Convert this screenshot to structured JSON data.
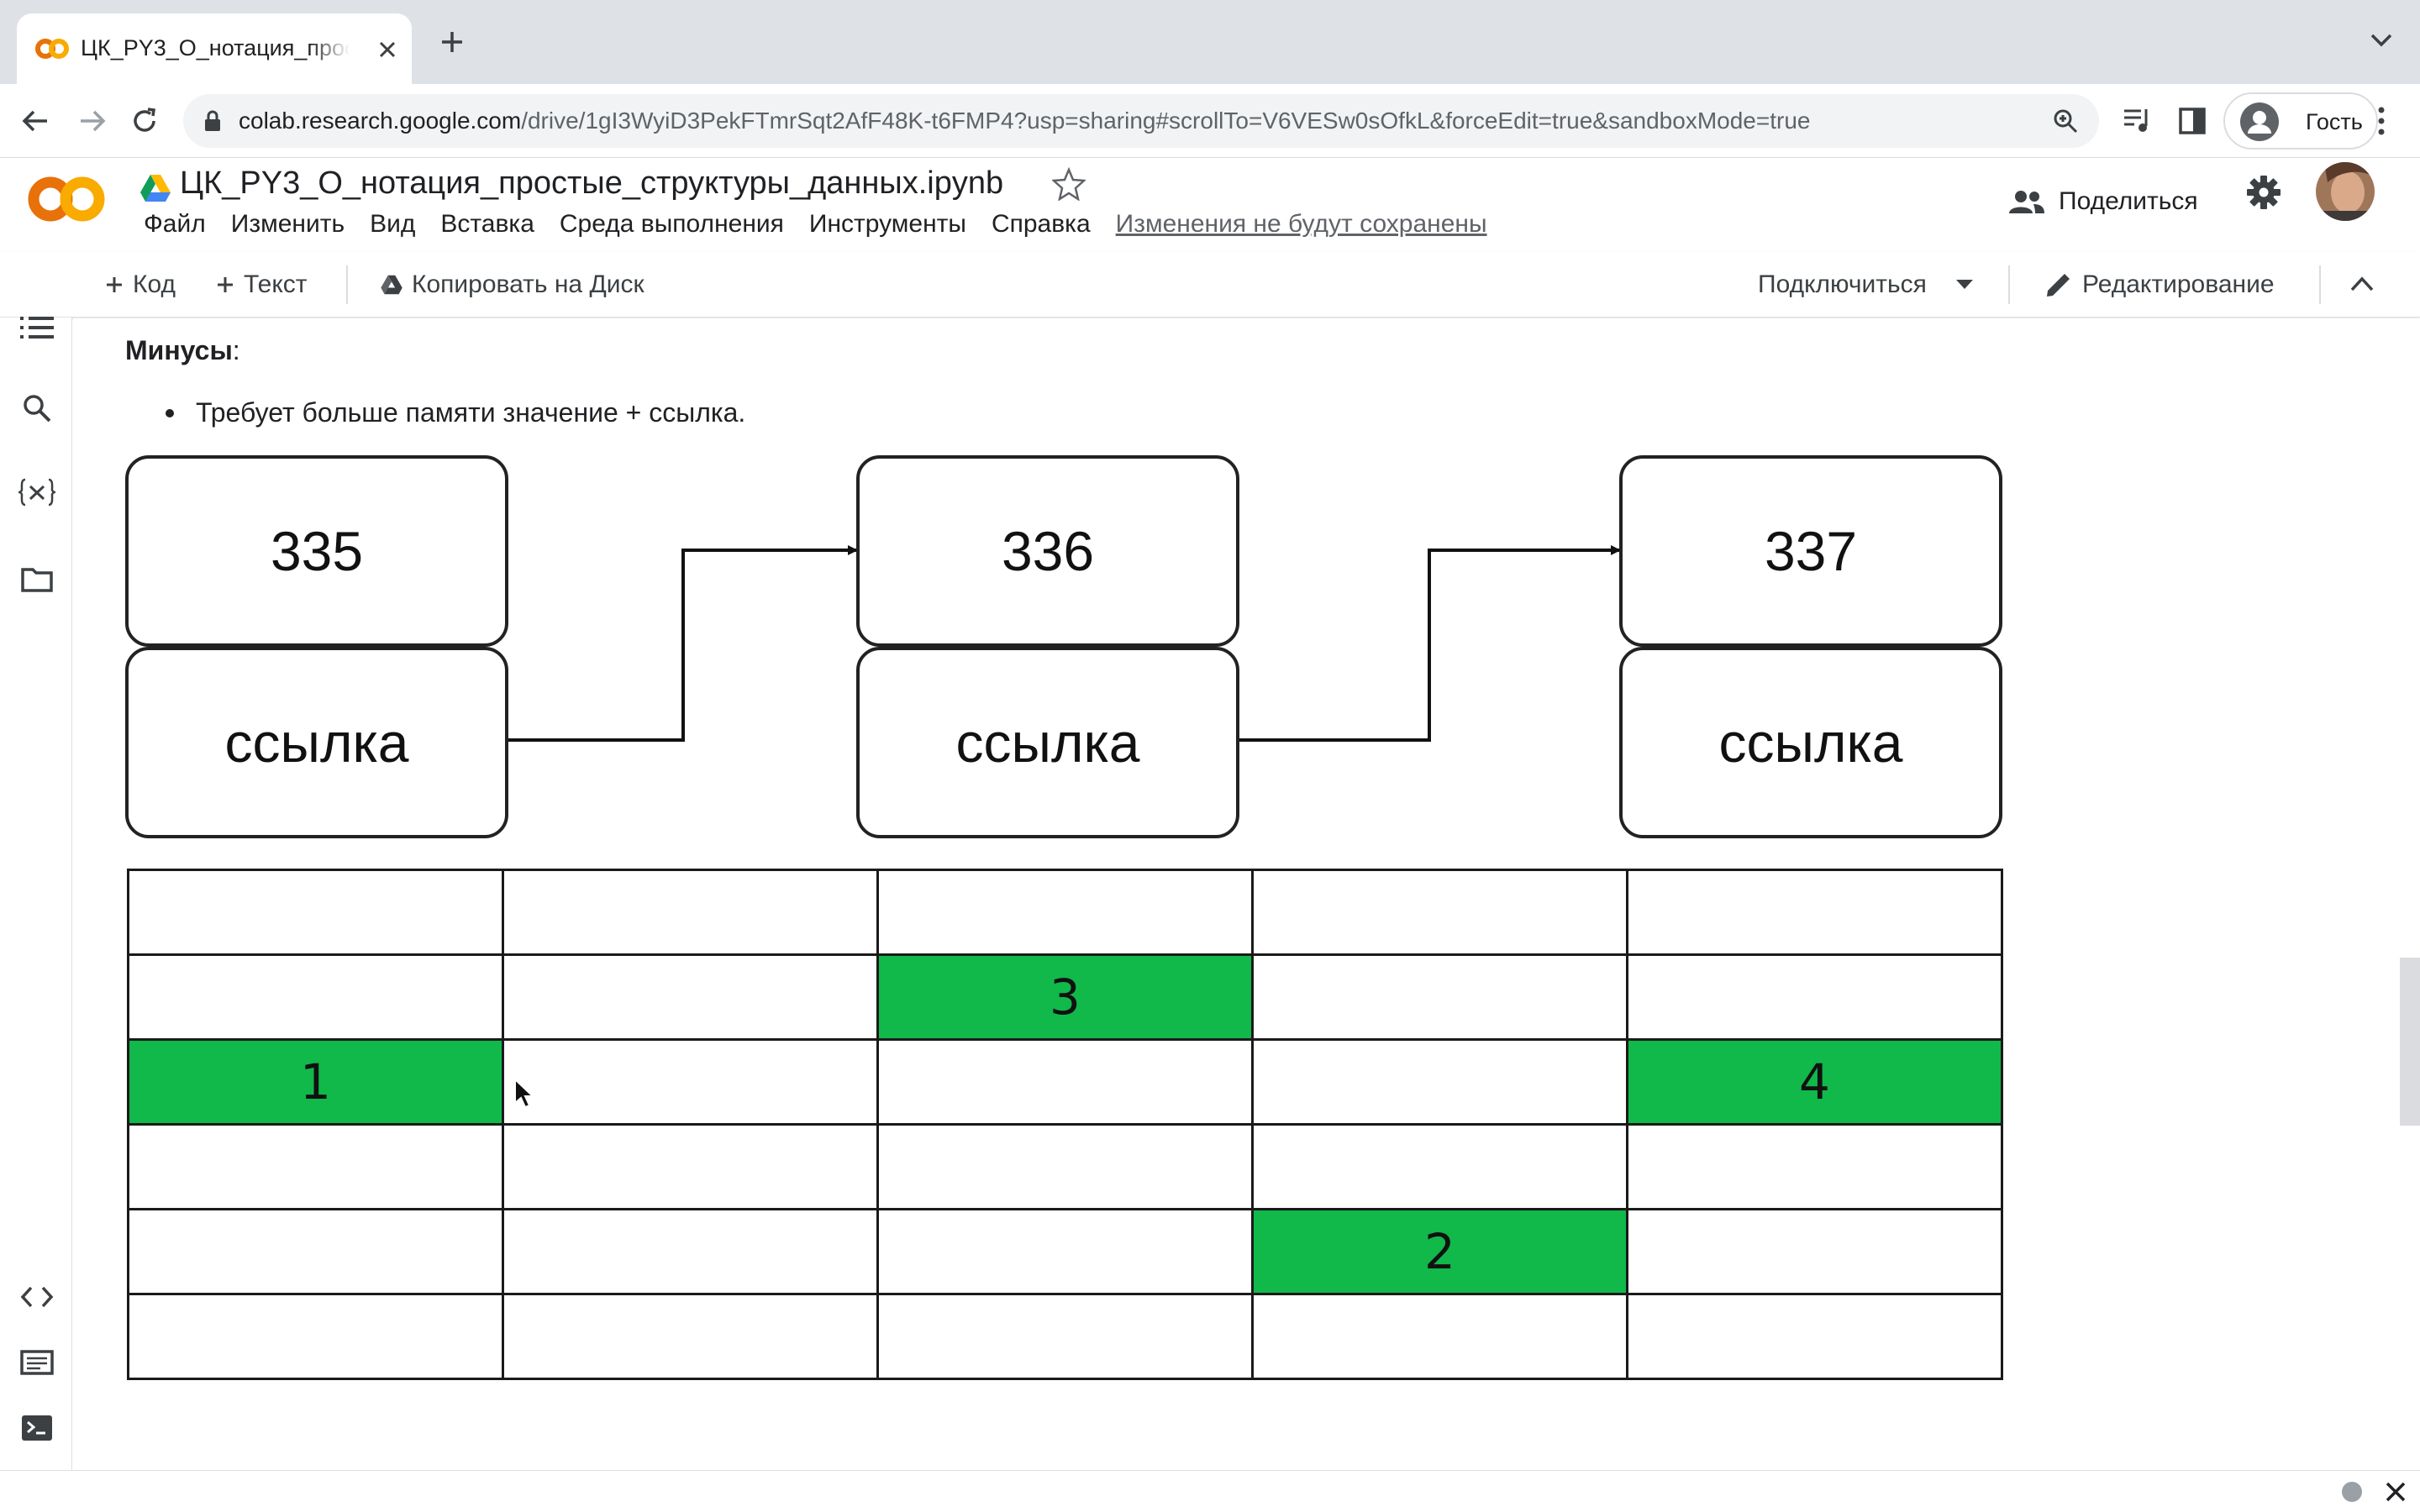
{
  "browser": {
    "tab_title": "ЦК_PY3_O_нотация_простые_структуры_данных",
    "url_host": "colab.research.google.com",
    "url_path": "/drive/1gI3WyiD3PekFTmrSqt2AfF48K-t6FMP4?usp=sharing#scrollTo=V6VESw0sOfkL&forceEdit=true&sandboxMode=true",
    "profile_label": "Гость"
  },
  "colab": {
    "logo_text": "CO",
    "notebook_title": "ЦК_PY3_O_нотация_простые_структуры_данных.ipynb",
    "menu": [
      "Файл",
      "Изменить",
      "Вид",
      "Вставка",
      "Среда выполнения",
      "Инструменты",
      "Справка"
    ],
    "unsaved_notice": "Изменения не будут сохранены",
    "share_label": "Поделиться"
  },
  "toolbar": {
    "add_code": "Код",
    "add_text": "Текст",
    "copy_to_drive": "Копировать на Диск",
    "connect": "Подключиться",
    "editing": "Редактирование"
  },
  "cell": {
    "minus_heading": "Минусы",
    "minus_colon": ":",
    "minus_item": "Требует больше памяти значение + ссылка."
  },
  "diagram": {
    "nodes": [
      {
        "value": "335",
        "link": "ссылка"
      },
      {
        "value": "336",
        "link": "ссылка"
      },
      {
        "value": "337",
        "link": "ссылка"
      }
    ]
  },
  "grid": {
    "rows": [
      [
        "",
        "",
        "",
        "",
        ""
      ],
      [
        "",
        "",
        "3",
        "",
        ""
      ],
      [
        "1",
        "",
        "",
        "",
        "4"
      ],
      [
        "",
        "",
        "",
        "",
        ""
      ],
      [
        "",
        "",
        "",
        "2",
        ""
      ],
      [
        "",
        "",
        "",
        "",
        ""
      ]
    ],
    "highlight_color": "#11b84a"
  },
  "colors": {
    "colab_orange": "#f9ab00",
    "colab_orange_dark": "#e8710a",
    "drive_green": "#0f9d58"
  }
}
